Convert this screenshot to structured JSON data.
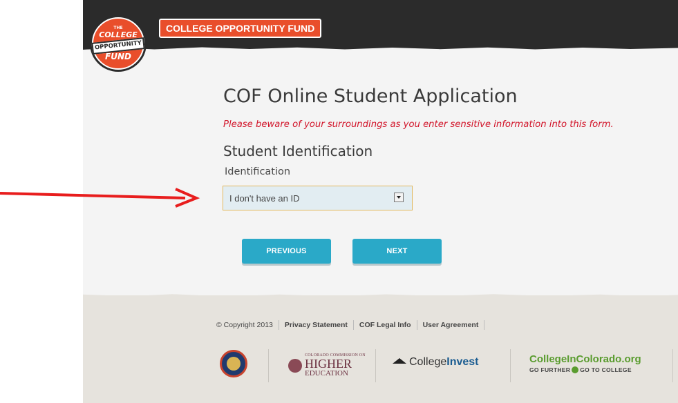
{
  "header": {
    "logo": {
      "the": "THE",
      "college": "COLLEGE",
      "opportunity": "OPPORTUNITY",
      "fund": "FUND"
    },
    "brand_label": "COLLEGE OPPORTUNITY FUND"
  },
  "page": {
    "title": "COF Online Student Application",
    "warning": "Please beware of your surroundings as you enter sensitive information into this form.",
    "section_title": "Student Identification",
    "field_label": "Identification",
    "identification_select": {
      "selected": "I don't have an ID"
    }
  },
  "buttons": {
    "previous": "PREVIOUS",
    "next": "NEXT"
  },
  "footer": {
    "copyright": "© Copyright 2013",
    "links": [
      "Privacy Statement",
      "COF Legal Info",
      "User Agreement"
    ],
    "logos": {
      "che_small": "COLORADO COMMISSION ON",
      "che_big": "HIGHER",
      "che_med": "EDUCATION",
      "ci_normal": "College",
      "ci_bold": "Invest",
      "cic_main": "CollegeInColorado.org",
      "cic_sub_left": "GO FURTHER",
      "cic_sub_right": "GO TO COLLEGE"
    }
  },
  "colors": {
    "header_bg": "#2b2b2b",
    "brand_orange": "#e94e2b",
    "warning_red": "#d2152a",
    "button_teal": "#2aa9c8",
    "annotation_arrow": "#e81d1d"
  }
}
